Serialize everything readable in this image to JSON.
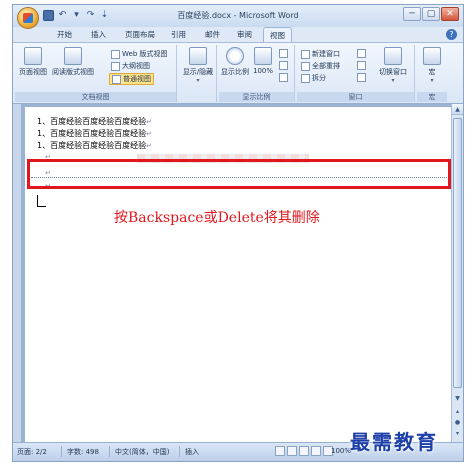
{
  "window": {
    "title": "百度经验.docx - Microsoft Word",
    "controls": {
      "minimize": "─",
      "maximize": "▢",
      "close": "✕"
    }
  },
  "quick_access": {
    "undo": "↶",
    "undo_dropdown": "▾",
    "redo": "↷",
    "customize": "⇣"
  },
  "tabs": [
    "开始",
    "插入",
    "页面布局",
    "引用",
    "邮件",
    "审阅",
    "视图"
  ],
  "active_tab": "视图",
  "ribbon": {
    "doc_views": {
      "label": "文档视图",
      "print_layout": "页面视图",
      "full_screen": "阅读版式视图",
      "web_layout": "Web 版式视图",
      "outline": "大纲视图",
      "draft": "普通视图"
    },
    "show_hide": {
      "label": "显示/隐藏",
      "dropdown": "▾"
    },
    "zoom": {
      "label": "显示比例",
      "zoom_btn": "显示比例",
      "hundred": "100%"
    },
    "window": {
      "label": "窗口",
      "new_window": "新建窗口",
      "arrange_all": "全部重排",
      "split": "拆分",
      "switch_windows": "切换窗口",
      "dropdown": "▾"
    },
    "macros": {
      "label": "宏",
      "btn": "宏",
      "dropdown": "▾"
    }
  },
  "document": {
    "lines": [
      "1、百度经验百度经验百度经验",
      "1、百度经验百度经验百度经验",
      "1、百度经验百度经验百度经验"
    ],
    "paragraph_mark": "↵",
    "annotation": "按Backspace或Delete将其删除"
  },
  "statusbar": {
    "page": "页面: 2/2",
    "words": "字数: 498",
    "language": "中文(简体，中国)",
    "mode": "插入",
    "zoom": "100%"
  },
  "watermark": "最需教育",
  "colors": {
    "annotation_red": "#e0171e",
    "ribbon_blue": "#dbe7f6",
    "watermark_blue": "#1d3fa8"
  }
}
